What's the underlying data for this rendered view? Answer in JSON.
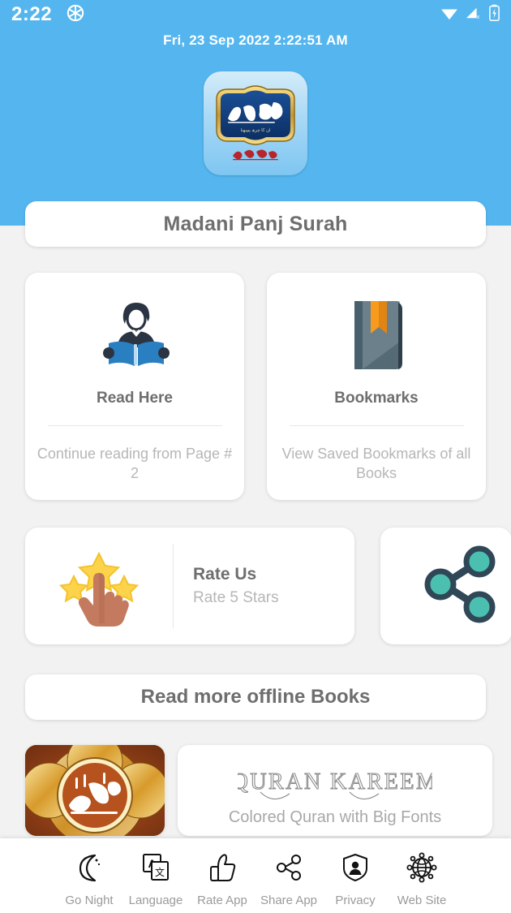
{
  "status_bar": {
    "time": "2:22",
    "aperture_icon": "camera-aperture-icon",
    "wifi_icon": "wifi-icon",
    "cellular_icon": "cellular-no-service-icon",
    "battery_icon": "battery-charging-icon"
  },
  "header": {
    "datetime": "Fri, 23 Sep 2022  2:22:51 AM",
    "bg_color": "#55b6ef",
    "logo_alt": "madani-panj-surah-logo"
  },
  "app_title": "Madani Panj Surah",
  "feature_cards": [
    {
      "icon": "person-reading-book-icon",
      "title": "Read Here",
      "subtitle": "Continue reading from Page # 2"
    },
    {
      "icon": "bookmarked-book-icon",
      "title": "Bookmarks",
      "subtitle": "View Saved Bookmarks of all Books"
    }
  ],
  "rate_card": {
    "icon": "hand-tapping-stars-icon",
    "title": "Rate Us",
    "subtitle": "Rate 5 Stars"
  },
  "share_card": {
    "icon": "share-nodes-icon"
  },
  "more_books_label": "Read more offline Books",
  "books": [
    {
      "thumb": "quran-ornate-cover-thumbnail",
      "title": "",
      "subtitle": ""
    },
    {
      "thumb": "",
      "title": "QURAN  KAREEM",
      "subtitle": "Colored Quran with Big Fonts"
    }
  ],
  "bottom_nav": [
    {
      "icon": "crescent-moon-icon",
      "label": "Go Night"
    },
    {
      "icon": "translate-icon",
      "label": "Language"
    },
    {
      "icon": "thumbs-up-icon",
      "label": "Rate App"
    },
    {
      "icon": "share-icon",
      "label": "Share App"
    },
    {
      "icon": "shield-person-icon",
      "label": "Privacy"
    },
    {
      "icon": "globe-network-icon",
      "label": "Web Site"
    }
  ],
  "colors": {
    "header_blue": "#55b6ef",
    "page_bg": "#f2f2f2",
    "text_gray": "#6e6e6e",
    "muted_gray": "#b6b6b6",
    "book_blue": "#2a7fc1",
    "bookmark_orange": "#f79a1e",
    "share_teal": "#4cc0b0",
    "star_yellow": "#fcd34a"
  }
}
